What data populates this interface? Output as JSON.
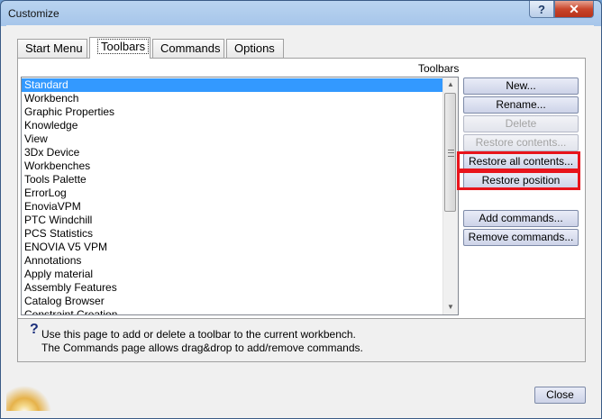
{
  "window": {
    "title": "Customize",
    "help_glyph": "?",
    "close_glyph": "✕"
  },
  "tabs": [
    {
      "label": "Start Menu",
      "active": false
    },
    {
      "label": "Toolbars",
      "active": true
    },
    {
      "label": "Commands",
      "active": false
    },
    {
      "label": "Options",
      "active": false
    }
  ],
  "toolbars": {
    "caption": "Toolbars",
    "items": [
      "Standard",
      "Workbench",
      "Graphic Properties",
      "Knowledge",
      "View",
      "3Dx Device",
      "Workbenches",
      "Tools Palette",
      "ErrorLog",
      "EnoviaVPM",
      "PTC Windchill",
      "PCS Statistics",
      "ENOVIA V5 VPM",
      "Annotations",
      "Apply material",
      "Assembly Features",
      "Catalog Browser",
      "Constraint Creation"
    ],
    "selected": "Standard"
  },
  "buttons": {
    "new": "New...",
    "rename": "Rename...",
    "delete": "Delete",
    "restore_contents": "Restore contents...",
    "restore_all_contents": "Restore all contents...",
    "restore_position": "Restore position",
    "add_commands": "Add commands...",
    "remove_commands": "Remove commands...",
    "close": "Close"
  },
  "help": {
    "icon": "?",
    "line1": "Use this page to add or delete a toolbar to the current workbench.",
    "line2": "The Commands page allows drag&drop to add/remove commands."
  },
  "colors": {
    "selection": "#3399ff",
    "highlight_border": "#e8141c"
  }
}
